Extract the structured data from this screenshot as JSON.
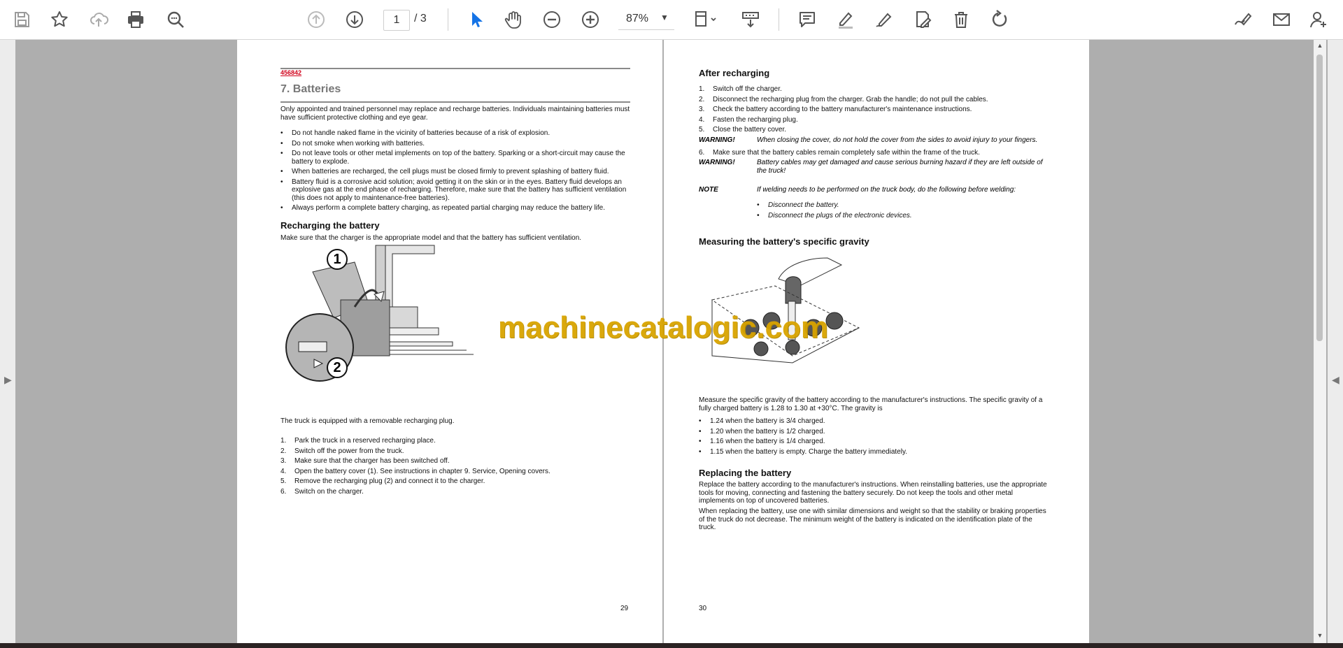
{
  "toolbar": {
    "icons": [
      "save-icon",
      "bookmark-star-icon",
      "upload-cloud-icon",
      "print-icon",
      "find-icon",
      "page-up-icon",
      "page-down-icon",
      "select-cursor-icon",
      "hand-tool-icon",
      "zoom-out-icon",
      "zoom-in-icon",
      "fit-page-icon",
      "scroll-mode-icon",
      "comment-icon",
      "highlight-icon",
      "draw-icon",
      "stamp-icon",
      "delete-icon",
      "rotate-icon",
      "sign-icon",
      "email-icon",
      "add-user-icon"
    ],
    "current_page": "1",
    "total_pages": "/ 3",
    "zoom": "87%"
  },
  "left_page": {
    "code": "456842",
    "title": "7. Batteries",
    "intro": "Only appointed and trained personnel may replace and recharge batteries. Individuals maintaining batteries must have sufficient protective clothing and eye gear.",
    "bullets": [
      "Do not handle naked flame in the vicinity of batteries because of a risk of explosion.",
      "Do not smoke when working with batteries.",
      "Do not leave tools or other metal implements on top of the battery. Sparking or a short-circuit may cause the battery to explode.",
      "When batteries are recharged, the cell plugs must be closed firmly to prevent splashing of battery fluid.",
      "Battery fluid is a corrosive acid solution; avoid getting it on the skin or in the eyes. Battery fluid develops an explosive gas at the end phase of recharging. Therefore, make sure that the battery has sufficient ventilation (this does not apply to maintenance-free batteries).",
      "Always perform a complete battery charging, as repeated partial charging may reduce the battery life."
    ],
    "recharging_heading": "Recharging the battery",
    "recharging_intro": "Make sure that the charger is the appropriate model and that the battery has sufficient ventilation.",
    "callout_1": "1",
    "callout_2": "2",
    "truck_note": "The truck is equipped with a removable recharging plug.",
    "steps": [
      {
        "n": "1.",
        "t": "Park the truck in a reserved recharging place."
      },
      {
        "n": "2.",
        "t": "Switch off the power from the truck."
      },
      {
        "n": "3.",
        "t": "Make sure that the charger has been switched off."
      },
      {
        "n": "4.",
        "t": "Open the battery cover (1). See instructions in chapter 9. Service, Opening covers."
      },
      {
        "n": "5.",
        "t": "Remove the recharging plug (2) and connect it to the charger."
      },
      {
        "n": "6.",
        "t": "Switch on the charger."
      }
    ],
    "page_number": "29"
  },
  "right_page": {
    "after_heading": "After recharging",
    "after_steps": [
      {
        "n": "1.",
        "t": "Switch off the charger."
      },
      {
        "n": "2.",
        "t": "Disconnect the recharging plug from the charger. Grab the handle; do not pull the cables."
      },
      {
        "n": "3.",
        "t": "Check the battery according to the battery manufacturer's maintenance instructions."
      },
      {
        "n": "4.",
        "t": "Fasten the recharging plug."
      },
      {
        "n": "5.",
        "t": "Close the battery cover."
      }
    ],
    "warning1_label": "WARNING!",
    "warning1_text": "When closing the cover, do not hold the cover from the sides to avoid injury to your fingers.",
    "step6_n": "6.",
    "step6_t": "Make sure that the battery cables remain completely safe within the frame of the truck.",
    "warning2_label": "WARNING!",
    "warning2_text": "Battery cables may get damaged and cause serious burning hazard if they are left outside of the truck!",
    "note_label": "NOTE",
    "note_text": "If welding needs to be performed on the truck body, do the following before welding:",
    "note_bullets": [
      "Disconnect the battery.",
      "Disconnect the plugs of the electronic devices."
    ],
    "gravity_heading": "Measuring the battery's specific gravity",
    "gravity_text": "Measure the specific gravity of the battery according to the manufacturer's instructions. The specific gravity of a fully charged battery is 1.28 to 1.30 at +30°C. The gravity is",
    "gravity_bullets": [
      "1.24 when the battery is 3/4 charged.",
      "1.20 when the battery is 1/2 charged.",
      "1.16 when the battery is 1/4 charged.",
      "1.15 when the battery is empty. Charge the battery immediately."
    ],
    "replacing_heading": "Replacing the battery",
    "replacing_p1": "Replace the battery according to the manufacturer's instructions. When reinstalling batteries, use the appropriate tools for moving, connecting and fastening the battery securely. Do not keep the tools and other metal implements on top of uncovered batteries.",
    "replacing_p2": "When replacing the battery, use one with similar dimensions and weight so that the stability or braking properties of the truck do not decrease. The minimum weight of the battery is indicated on the identification plate of the truck.",
    "page_number": "30"
  },
  "watermark": "machinecatalogic.com",
  "colors": {
    "accent_blue": "#1473e6",
    "watermark": "#d9a400",
    "code_red": "#d0021b",
    "viewer_bg": "#aeaeae"
  }
}
